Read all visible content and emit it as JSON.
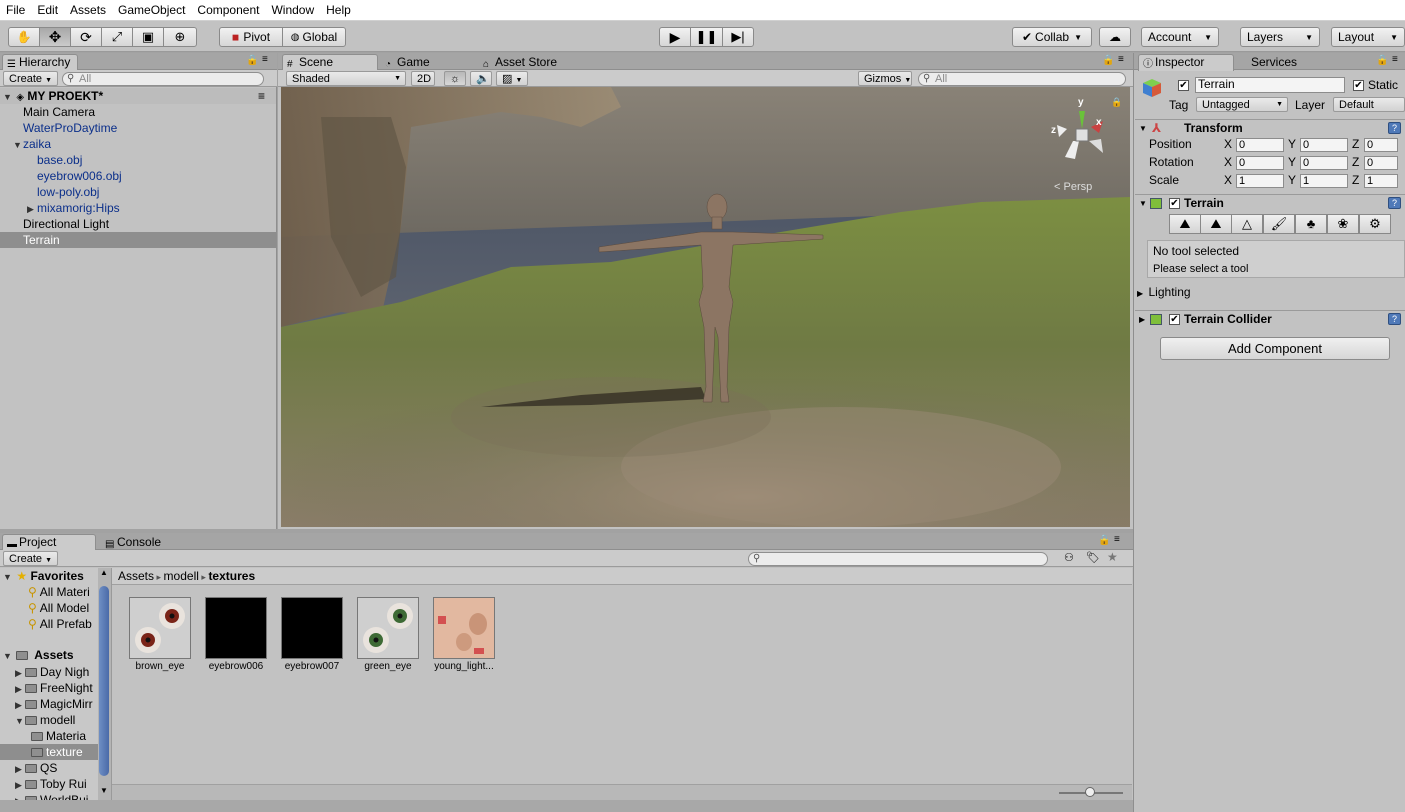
{
  "menu": [
    "File",
    "Edit",
    "Assets",
    "GameObject",
    "Component",
    "Window",
    "Help"
  ],
  "toolbar": {
    "tools": [
      "hand-icon",
      "move-icon",
      "rotate-icon",
      "scale-icon",
      "rect-icon",
      "transform-icon"
    ],
    "pivot": "Pivot",
    "global": "Global",
    "collab": "Collab",
    "account": "Account",
    "layers": "Layers",
    "layout": "Layout"
  },
  "hierarchy": {
    "tab": "Hierarchy",
    "create": "Create",
    "search_placeholder": "All",
    "scene_name": "MY PROEKT*",
    "items": [
      {
        "label": "Main Camera",
        "indent": 1,
        "blue": false,
        "arrow": "",
        "sel": false
      },
      {
        "label": "WaterProDaytime",
        "indent": 1,
        "blue": true,
        "arrow": "",
        "sel": false
      },
      {
        "label": "zaika",
        "indent": 1,
        "blue": true,
        "arrow": "down",
        "sel": false
      },
      {
        "label": "base.obj",
        "indent": 2,
        "blue": true,
        "arrow": "",
        "sel": false
      },
      {
        "label": "eyebrow006.obj",
        "indent": 2,
        "blue": true,
        "arrow": "",
        "sel": false
      },
      {
        "label": "low-poly.obj",
        "indent": 2,
        "blue": true,
        "arrow": "",
        "sel": false
      },
      {
        "label": "mixamorig:Hips",
        "indent": 2,
        "blue": true,
        "arrow": "right",
        "sel": false
      },
      {
        "label": "Directional Light",
        "indent": 1,
        "blue": false,
        "arrow": "",
        "sel": false
      },
      {
        "label": "Terrain",
        "indent": 1,
        "blue": false,
        "arrow": "",
        "sel": true
      }
    ]
  },
  "scene": {
    "tabs": [
      "Scene",
      "Game",
      "Asset Store"
    ],
    "shaded": "Shaded",
    "mode2d": "2D",
    "gizmos": "Gizmos",
    "search_placeholder": "All",
    "persp": "Persp",
    "axis_y": "y",
    "axis_x": "x",
    "axis_z": "z"
  },
  "inspector": {
    "tabs": [
      "Inspector",
      "Services"
    ],
    "object_name": "Terrain",
    "static": "Static",
    "tag_label": "Tag",
    "tag_value": "Untagged",
    "layer_label": "Layer",
    "layer_value": "Default",
    "transform": {
      "title": "Transform",
      "rows": [
        {
          "label": "Position",
          "x": "0",
          "y": "0",
          "z": "0"
        },
        {
          "label": "Rotation",
          "x": "0",
          "y": "0",
          "z": "0"
        },
        {
          "label": "Scale",
          "x": "1",
          "y": "1",
          "z": "1"
        }
      ],
      "axis_labels": [
        "X",
        "Y",
        "Z"
      ]
    },
    "terrain": {
      "title": "Terrain",
      "tool_icons": [
        "raise-terrain-icon",
        "paint-height-icon",
        "smooth-height-icon",
        "paint-texture-icon",
        "place-trees-icon",
        "paint-details-icon",
        "terrain-settings-icon"
      ],
      "no_tool": "No tool selected",
      "select_tool": "Please select a tool"
    },
    "lighting": "Lighting",
    "terrain_collider": "Terrain Collider",
    "add_component": "Add Component"
  },
  "project": {
    "tabs": [
      "Project",
      "Console"
    ],
    "create": "Create",
    "breadcrumb": [
      "Assets",
      "modell",
      "textures"
    ],
    "favorites_title": "Favorites",
    "favorites": [
      "All Materi",
      "All Model",
      "All Prefab"
    ],
    "assets_title": "Assets",
    "folders": [
      {
        "label": "Day Nigh",
        "indent": 1,
        "arrow": "right",
        "sel": false
      },
      {
        "label": "FreeNight",
        "indent": 1,
        "arrow": "right",
        "sel": false
      },
      {
        "label": "MagicMirr",
        "indent": 1,
        "arrow": "right",
        "sel": false
      },
      {
        "label": "modell",
        "indent": 1,
        "arrow": "down",
        "sel": false
      },
      {
        "label": "Materia",
        "indent": 2,
        "arrow": "",
        "sel": false
      },
      {
        "label": "texture",
        "indent": 2,
        "arrow": "",
        "sel": true
      },
      {
        "label": "QS",
        "indent": 1,
        "arrow": "right",
        "sel": false
      },
      {
        "label": "Toby Rui",
        "indent": 1,
        "arrow": "right",
        "sel": false
      },
      {
        "label": "WorldBui",
        "indent": 1,
        "arrow": "right",
        "sel": false
      }
    ],
    "assets": [
      {
        "label": "brown_eye",
        "kind": "brown"
      },
      {
        "label": "eyebrow006",
        "kind": "black"
      },
      {
        "label": "eyebrow007",
        "kind": "black"
      },
      {
        "label": "green_eye",
        "kind": "green"
      },
      {
        "label": "young_light...",
        "kind": "skin"
      }
    ]
  }
}
